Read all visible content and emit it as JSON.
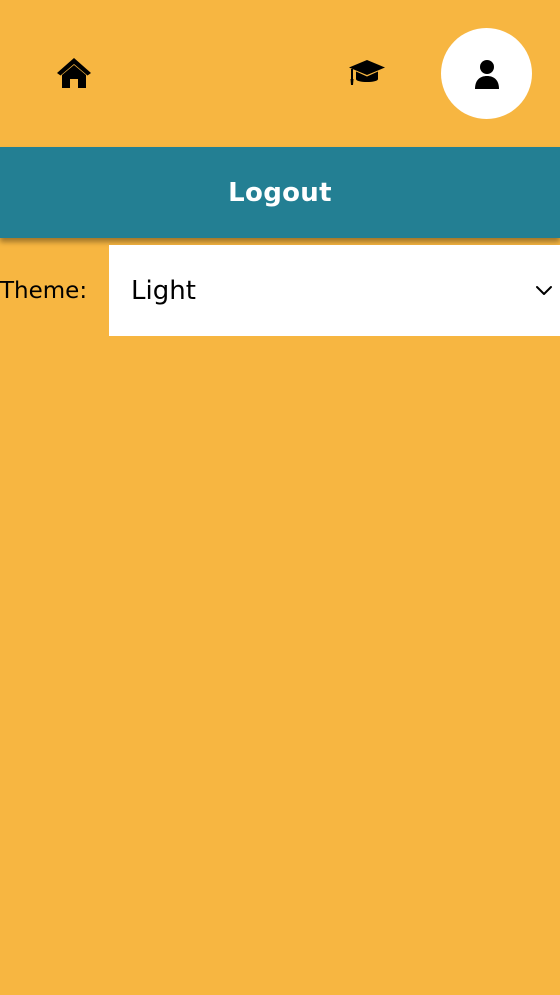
{
  "nav": {
    "home_icon": "home-icon",
    "courses_icon": "graduation-cap-icon",
    "profile_icon": "user-icon"
  },
  "logout": {
    "label": "Logout"
  },
  "theme": {
    "label": "Theme:",
    "selected": "Light"
  },
  "colors": {
    "background": "#F7B641",
    "logout_bar": "#237F93",
    "profile_circle": "#FFFFFF",
    "select_bg": "#FFFFFF"
  }
}
